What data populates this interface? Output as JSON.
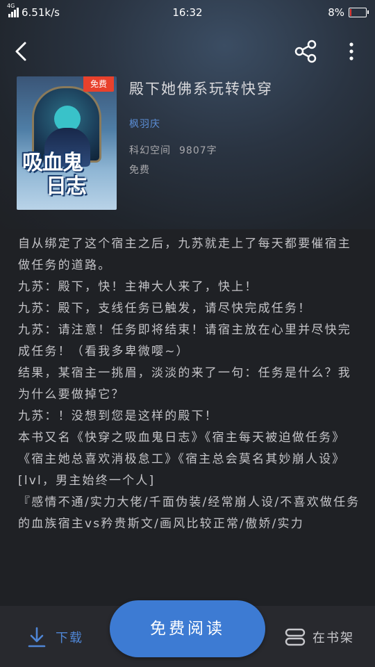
{
  "status_bar": {
    "network_type": "4G",
    "speed": "6.51k/s",
    "time": "16:32",
    "battery": "8%",
    "battery_level": 0.08
  },
  "nav": {
    "back_icon": "back-arrow-icon",
    "share_icon": "share-icon",
    "more_icon": "more-vertical-icon"
  },
  "book": {
    "cover_tag": "免费",
    "cover_title_line1": "吸血鬼",
    "cover_title_line2": "日志",
    "title": "殿下她佛系玩转快穿",
    "author": "枫羽庆",
    "category": "科幻空间",
    "word_count": "9807字",
    "price": "免费"
  },
  "intro": [
    "自从绑定了这个宿主之后，九苏就走上了每天都要催宿主做任务的道路。",
    "九苏：殿下，快！主神大人来了，快上！",
    "九苏：殿下，支线任务已触发，请尽快完成任务！",
    "九苏：请注意！任务即将结束！请宿主放在心里并尽快完成任务！（看我多卑微嘤~）",
    "结果，某宿主一挑眉，淡淡的来了一句：任务是什么？我为什么要做掉它？",
    "九苏：！没想到您是这样的殿下！",
    "本书又名《快穿之吸血鬼日志》《宿主每天被迫做任务》《宿主她总喜欢消极怠工》《宿主总会莫名其妙崩人设》",
    "[lvl，男主始终一个人]",
    "『感情不通/实力大佬/千面伪装/经常崩人设/不喜欢做任务的血族宿主vs矜贵斯文/画风比较正常/傲娇/实力"
  ],
  "bottom": {
    "download_label": "下载",
    "read_label": "免费阅读",
    "shelf_label": "在书架"
  },
  "colors": {
    "accent": "#3d7bd3",
    "author_link": "#5b8ed6",
    "free_tag": "#e8412c",
    "background": "#1f2125"
  }
}
